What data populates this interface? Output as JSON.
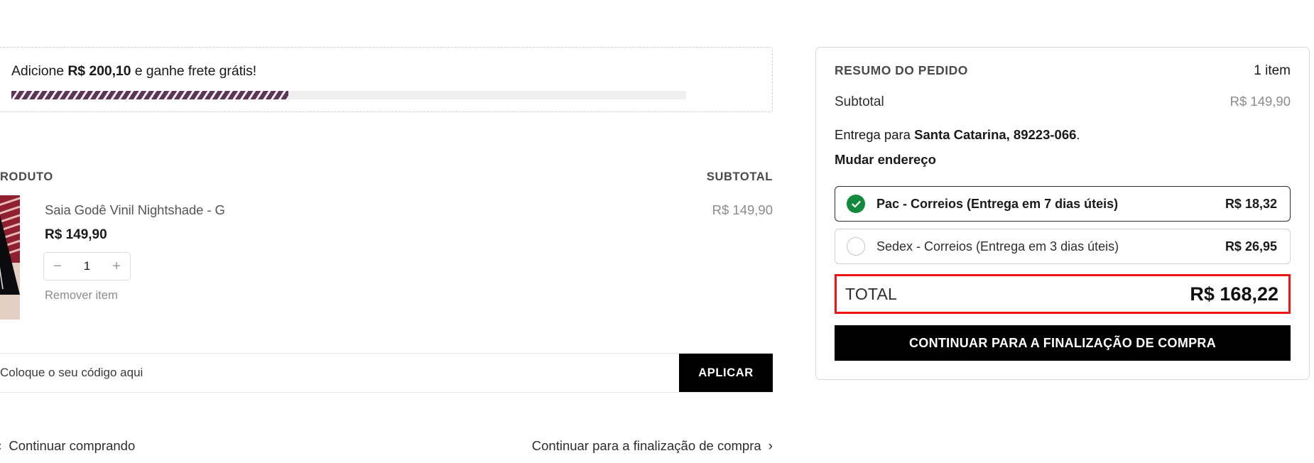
{
  "shipping_banner": {
    "prefix": "Adicione ",
    "amount": "R$ 200,10",
    "suffix": " e ganhe frete grátis!",
    "progress_percent": 41,
    "fill_color": "#5c3557",
    "track_color": "#efefef"
  },
  "cart_table": {
    "col_product": "RODUTO",
    "col_subtotal": "SUBTOTAL",
    "item": {
      "name": "Saia Godê Vinil Nightshade - G",
      "price": "R$ 149,90",
      "quantity": "1",
      "decrease_label": "−",
      "increase_label": "+",
      "remove_label": "Remover item",
      "subtotal": "R$ 149,90"
    }
  },
  "coupon": {
    "placeholder": "Coloque o seu código aqui",
    "value": "",
    "apply_label": "APLICAR"
  },
  "bottom_nav": {
    "back_label": "Continuar comprando",
    "back_chevron": "‹",
    "forward_label": "Continuar para a finalização de compra",
    "forward_chevron": "›"
  },
  "summary": {
    "title": "RESUMO DO PEDIDO",
    "item_count": "1 item",
    "subtotal_label": "Subtotal",
    "subtotal_value": "R$ 149,90",
    "delivery_prefix": "Entrega para ",
    "delivery_address": "Santa Catarina, 89223-066",
    "delivery_suffix": ".",
    "change_address_label": "Mudar endereço",
    "shipping_options": [
      {
        "name": "Pac - Correios (Entrega em 7 dias úteis)",
        "price": "R$ 18,32",
        "selected": true
      },
      {
        "name": "Sedex - Correios (Entrega em 3 dias úteis)",
        "price": "R$ 26,95",
        "selected": false
      }
    ],
    "total_label": "TOTAL",
    "total_value": "R$ 168,22",
    "total_highlight_color": "#f01313",
    "checkout_label": "CONTINUAR PARA A FINALIZAÇÃO DE COMPRA"
  }
}
